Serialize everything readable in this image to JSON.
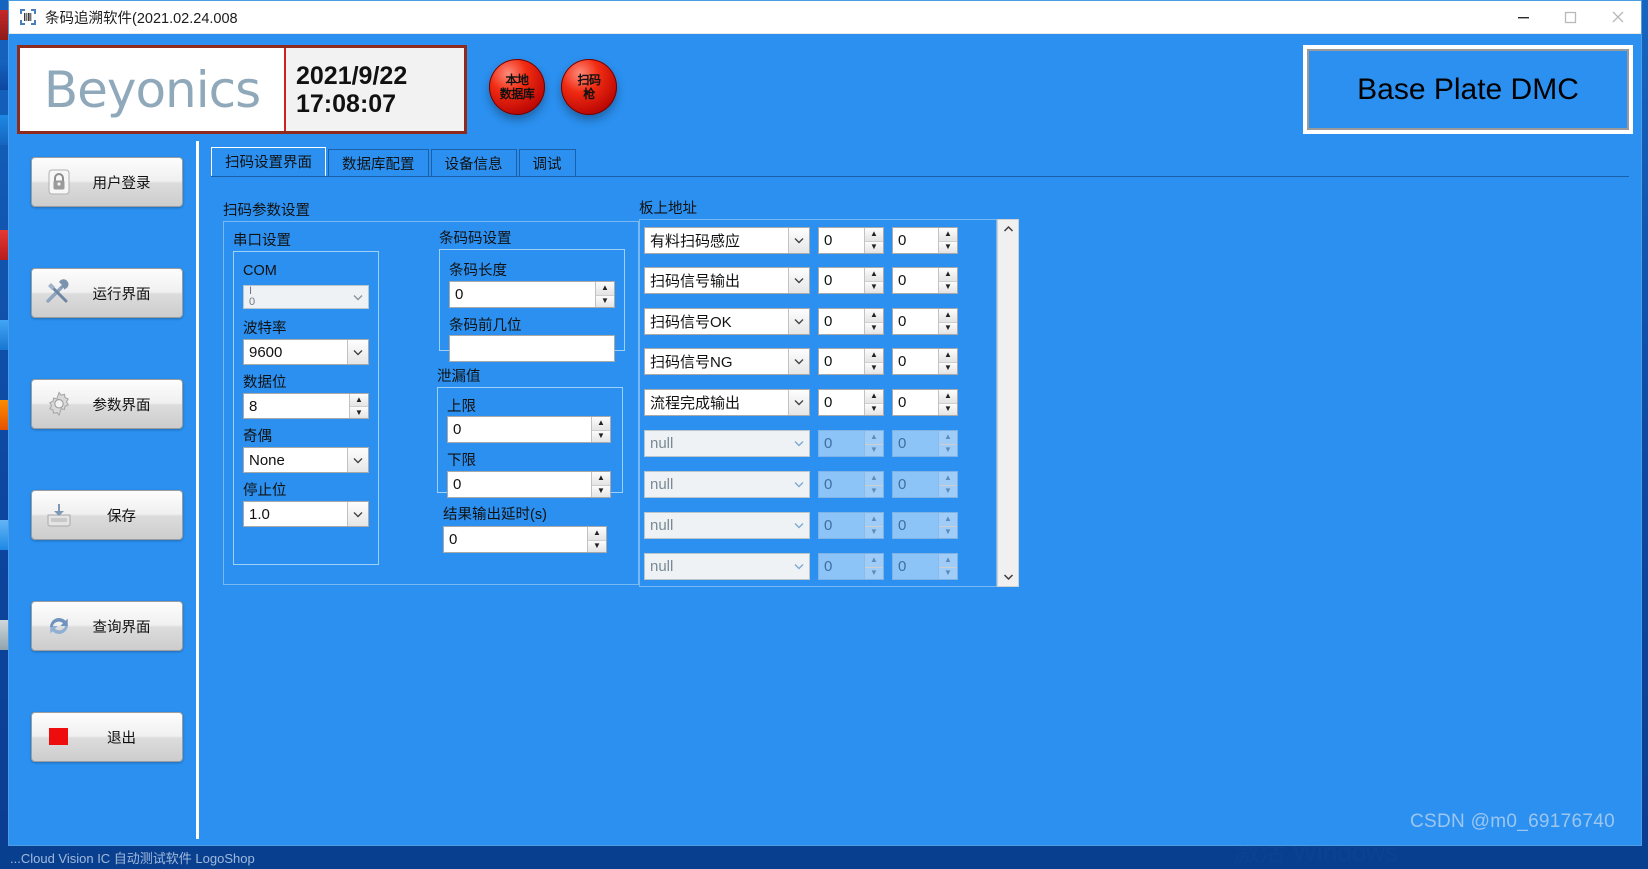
{
  "window": {
    "title": "条码追溯软件(2021.02.24.008",
    "icon": "barcode-scanner-icon",
    "controls": {
      "minimize": "—",
      "maximize": "□",
      "close": "✕"
    }
  },
  "header": {
    "logo_text": "Beyonics",
    "date": "2021/9/22",
    "time": "17:08:07",
    "leds": [
      {
        "id": "local-database",
        "line1": "本地",
        "line2": "数据库",
        "color": "#e01f0d"
      },
      {
        "id": "scanner-gun",
        "line1": "扫码",
        "line2": "枪",
        "color": "#e01f0d"
      }
    ],
    "station_title": "Base Plate DMC"
  },
  "sidebar": {
    "items": [
      {
        "label": "用户登录",
        "icon": "lock-icon",
        "name": "user-login"
      },
      {
        "label": "运行界面",
        "icon": "tools-icon",
        "name": "run-screen"
      },
      {
        "label": "参数界面",
        "icon": "gear-icon",
        "name": "parameter-screen"
      },
      {
        "label": "保存",
        "icon": "save-disk-icon",
        "name": "save"
      },
      {
        "label": "查询界面",
        "icon": "refresh-icon",
        "name": "query-screen"
      },
      {
        "label": "退出",
        "icon": "stop-square-icon",
        "name": "exit"
      }
    ]
  },
  "tabs": [
    {
      "label": "扫码设置界面",
      "active": true
    },
    {
      "label": "数据库配置",
      "active": false
    },
    {
      "label": "设备信息",
      "active": false
    },
    {
      "label": "调试",
      "active": false
    }
  ],
  "scan_params": {
    "group_title": "扫码参数设置",
    "serial": {
      "title": "串口设置",
      "com": {
        "label": "COM",
        "value": "",
        "disabled": true
      },
      "baud": {
        "label": "波特率",
        "value": "9600"
      },
      "databits": {
        "label": "数据位",
        "value": "8"
      },
      "parity": {
        "label": "奇偶",
        "value": "None"
      },
      "stopbits": {
        "label": "停止位",
        "value": "1.0"
      }
    },
    "barcode": {
      "title": "条码码设置",
      "length": {
        "label": "条码长度",
        "value": "0"
      },
      "prefix": {
        "label": "条码前几位",
        "value": ""
      }
    },
    "leak": {
      "title": "泄漏值",
      "upper": {
        "label": "上限",
        "value": "0"
      },
      "lower": {
        "label": "下限",
        "value": "0"
      }
    },
    "delay": {
      "label": "结果输出延时(s)",
      "value": "0"
    }
  },
  "board_address": {
    "group_title": "板上地址",
    "rows": [
      {
        "name": "有料扫码感应",
        "addr": "0",
        "bit": "0",
        "disabled": false
      },
      {
        "name": "扫码信号输出",
        "addr": "0",
        "bit": "0",
        "disabled": false
      },
      {
        "name": "扫码信号OK",
        "addr": "0",
        "bit": "0",
        "disabled": false
      },
      {
        "name": "扫码信号NG",
        "addr": "0",
        "bit": "0",
        "disabled": false
      },
      {
        "name": "流程完成输出",
        "addr": "0",
        "bit": "0",
        "disabled": false
      },
      {
        "name": "null",
        "addr": "0",
        "bit": "0",
        "disabled": true
      },
      {
        "name": "null",
        "addr": "0",
        "bit": "0",
        "disabled": true
      },
      {
        "name": "null",
        "addr": "0",
        "bit": "0",
        "disabled": true
      },
      {
        "name": "null",
        "addr": "0",
        "bit": "0",
        "disabled": true
      }
    ],
    "scroll": {
      "up": "⌃",
      "down": "⌄"
    }
  },
  "watermark": "CSDN @m0_69176740",
  "desktop": {
    "taskbar_text": "...Cloud    Vision IC    自动测试软件    LogoShop",
    "windows_text": "激活 Windows"
  },
  "colors": {
    "client_blue": "#2b90f0",
    "logo_border": "#8e2b1c",
    "led_red": "#e01f0d"
  }
}
